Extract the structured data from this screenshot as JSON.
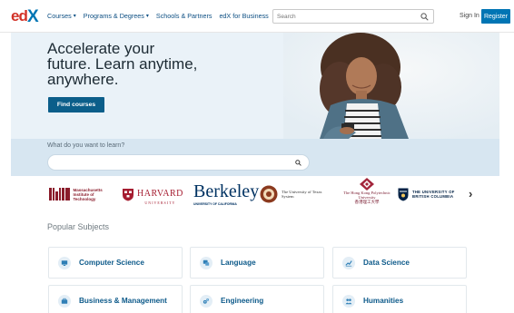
{
  "header": {
    "nav": [
      {
        "label": "Courses",
        "has_dropdown": true
      },
      {
        "label": "Programs & Degrees",
        "has_dropdown": true
      },
      {
        "label": "Schools & Partners",
        "has_dropdown": false
      },
      {
        "label": "edX for Business",
        "has_dropdown": false
      }
    ],
    "search_placeholder": "Search",
    "signin_label": "Sign In",
    "register_label": "Register"
  },
  "hero": {
    "title": "Accelerate your future. Learn anytime, anywhere.",
    "cta_label": "Find courses"
  },
  "learn": {
    "prompt": "What do you want to learn?",
    "search_placeholder": ""
  },
  "partners": {
    "mit": "Massachusetts Institute of Technology",
    "harvard": "HARVARD",
    "harvard_sub": "UNIVERSITY",
    "berkeley": "Berkeley",
    "berkeley_sub": "UNIVERSITY OF CALIFORNIA",
    "texas": "The University of Texas System",
    "hongkong": "The Hong Kong Polytechnic University",
    "hongkong_cn": "香港理工大學",
    "ubc": "THE UNIVERSITY OF BRITISH COLUMBIA"
  },
  "popular": {
    "heading": "Popular Subjects",
    "subjects": [
      {
        "label": "Computer Science",
        "icon": "monitor-icon"
      },
      {
        "label": "Language",
        "icon": "language-icon"
      },
      {
        "label": "Data Science",
        "icon": "chart-icon"
      },
      {
        "label": "Business & Management",
        "icon": "briefcase-icon"
      },
      {
        "label": "Engineering",
        "icon": "gears-icon"
      },
      {
        "label": "Humanities",
        "icon": "people-icon"
      }
    ]
  },
  "colors": {
    "brand_red": "#d23228",
    "brand_blue": "#0075b4",
    "hero_bg": "#eaf2f8",
    "learn_bg": "#d7e6f1",
    "subject_text": "#0d5a8a"
  }
}
